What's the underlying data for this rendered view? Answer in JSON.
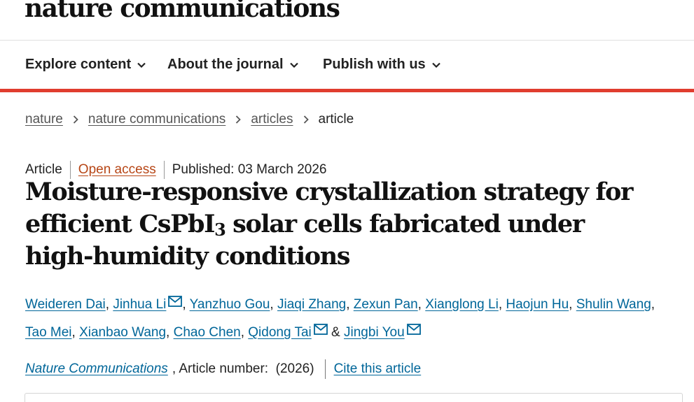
{
  "site": {
    "logo": "nature communications"
  },
  "nav": {
    "items": [
      {
        "label": "Explore content"
      },
      {
        "label": "About the journal"
      },
      {
        "label": "Publish with us"
      }
    ]
  },
  "breadcrumb": {
    "items": [
      "nature",
      "nature communications",
      "articles"
    ],
    "current": "article"
  },
  "article": {
    "type": "Article",
    "access": "Open access",
    "published": "Published: 03 March 2026",
    "title_part1": "Moisture-responsive crystallization strategy for efficient CsPbI",
    "title_sub": "3",
    "title_part2": " solar cells fabricated under high-humidity conditions",
    "authors": [
      "Weideren Dai",
      "Jinhua Li",
      "Yanzhuo Gou",
      "Jiaqi Zhang",
      "Zexun Pan",
      "Xianglong Li",
      "Haojun Hu",
      "Shulin Wang",
      "Tao Mei",
      "Xianbao Wang",
      "Chao Chen",
      "Qidong Tai",
      "Jingbi You"
    ],
    "journal": "Nature Communications",
    "article_number": ", Article number:  (2026)",
    "cite_label": "Cite this article"
  },
  "colors": {
    "accent_red": "#e03d2f",
    "link_blue": "#006699",
    "open_access_orange": "#b74616"
  },
  "icons": {
    "nav_toggle": "chevron-down-icon",
    "breadcrumb_sep": "chevron-right-icon",
    "author_contact": "envelope-icon"
  }
}
